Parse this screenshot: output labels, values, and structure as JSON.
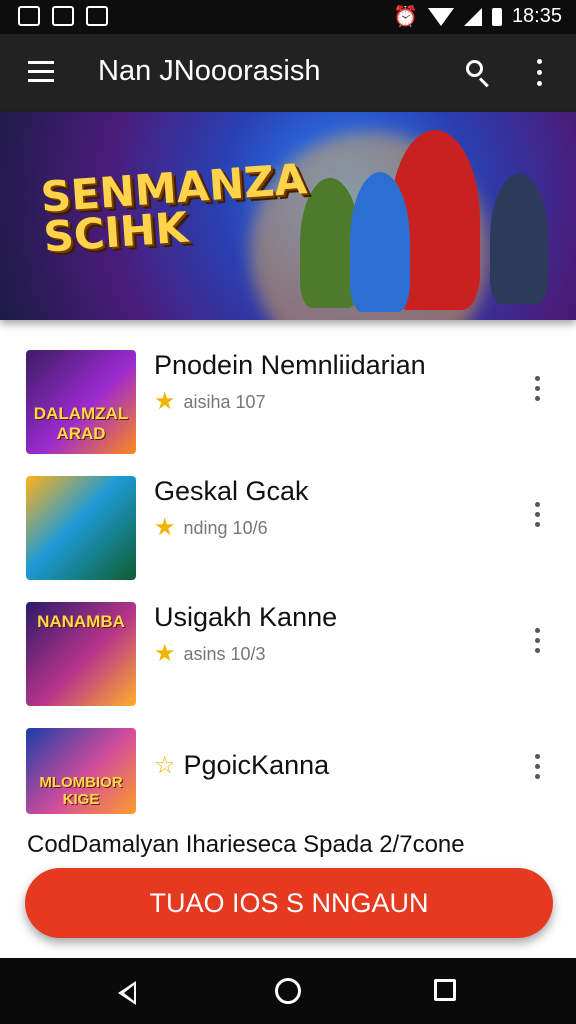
{
  "status_bar": {
    "time": "18:35",
    "icons": [
      "notification-icon",
      "notification-icon",
      "notification-icon",
      "alarm-icon",
      "wifi-icon",
      "signal-icon",
      "battery-icon"
    ]
  },
  "app_bar": {
    "title": "Nan JNooorasish",
    "icons": [
      "menu-icon",
      "search-icon",
      "more-vert-icon"
    ]
  },
  "banner": {
    "title": "SENMANZA SCIHK"
  },
  "games": [
    {
      "title": "Pnodein Nemnliidarian",
      "rating": "aisiha 107",
      "thumb_text": "DALAMZAL ARAD",
      "star": "filled"
    },
    {
      "title": "Geskal Gcak",
      "rating": "nding 10/6",
      "thumb_text": "",
      "star": "filled"
    },
    {
      "title": "Usigakh Kanne",
      "rating": "asins 10/3",
      "thumb_text": "NANAMBA",
      "star": "filled"
    },
    {
      "title": "PgoicKanna",
      "rating": "",
      "thumb_text": "MLOMBIOR KIGE",
      "star": "outline"
    }
  ],
  "caption": "CodDamalyan Iharieseca Spada 2/7cone",
  "cta_label": "TUAO IOS S NNGAUN",
  "colors": {
    "app_bar_bg": "#222222",
    "status_bar_bg": "#0d0d0d",
    "cta_bg": "#e53a1f",
    "star": "#f0b400"
  },
  "nav_icons": [
    "back-icon",
    "home-icon",
    "recents-icon"
  ]
}
